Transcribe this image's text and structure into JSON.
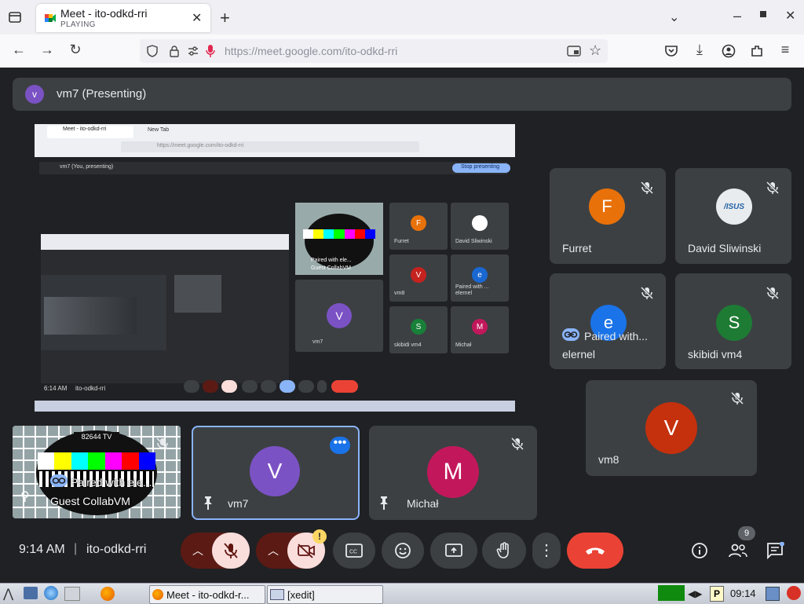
{
  "browser": {
    "tab": {
      "title": "Meet - ito-odkd-rri",
      "status": "PLAYING"
    },
    "url": {
      "prefix": "https://meet.google.com/",
      "path": "ito-odkd-rri"
    }
  },
  "meet": {
    "presenting": {
      "avatar": "v",
      "label": "vm7 (Presenting)"
    },
    "screen_share": {
      "mini_tab1": "Meet - ito-odkd-rri",
      "mini_tab2": "New Tab",
      "mini_url": "https://meet.google.com/ito-odkd-rri",
      "mini_present_label": "vm7 (You, presenting)",
      "mini_stop_label": "Stop presenting",
      "mini_time": "6:14 AM",
      "mini_code": "ito-odkd-rri",
      "mini_tiles": [
        {
          "avatar": "F",
          "name": "Furret",
          "color": "#e8710a"
        },
        {
          "avatar": "",
          "name": "David Sliwinski",
          "color": "#ffffff"
        },
        {
          "avatar": "V",
          "name": "vm8",
          "color": "#c5221f"
        },
        {
          "avatar": "e",
          "name": "elernel",
          "color": "#1967d2",
          "tag": "Paired with ..."
        },
        {
          "avatar": "S",
          "name": "skibidi vm4",
          "color": "#188038"
        },
        {
          "avatar": "M",
          "name": "Michał",
          "color": "#c2185b"
        }
      ],
      "mini_vm7": "vm7",
      "mini_paired": "Paired with ele...",
      "mini_guest": "Guest CollabVM"
    },
    "tiles": {
      "furret": {
        "avatar": "F",
        "name": "Furret",
        "color": "#e8710a"
      },
      "david": {
        "avatar_text": "/ISUS",
        "name": "David Sliwinski"
      },
      "elernel": {
        "avatar": "e",
        "name": "elernel",
        "tag": "Paired with...",
        "color": "#1a73e8"
      },
      "skibidi": {
        "avatar": "S",
        "name": "skibidi vm4",
        "color": "#1e7b34"
      },
      "vm8": {
        "avatar": "V",
        "name": "vm8",
        "color": "#c5300d"
      },
      "guest": {
        "tv_label": "82644 TV",
        "tag": "Paired with ele...",
        "name": "Guest CollabVM"
      },
      "vm7": {
        "avatar": "V",
        "name": "vm7",
        "color": "#7b52c4"
      },
      "michal": {
        "avatar": "M",
        "name": "Michał",
        "color": "#c2185b"
      }
    },
    "footer": {
      "time": "9:14 AM",
      "separator": "|",
      "code": "ito-odkd-rri",
      "people_count": "9",
      "cam_warning": "!"
    }
  },
  "os": {
    "tasks": [
      {
        "label": "Meet - ito-odkd-r..."
      },
      {
        "label": "[xedit]"
      }
    ],
    "clock": "09:14",
    "tray_p": "P"
  },
  "colors": {
    "meet_bg": "#202124",
    "tile_bg": "#3c4043",
    "end_call": "#ea4335",
    "accent_blue": "#8ab4f8"
  }
}
